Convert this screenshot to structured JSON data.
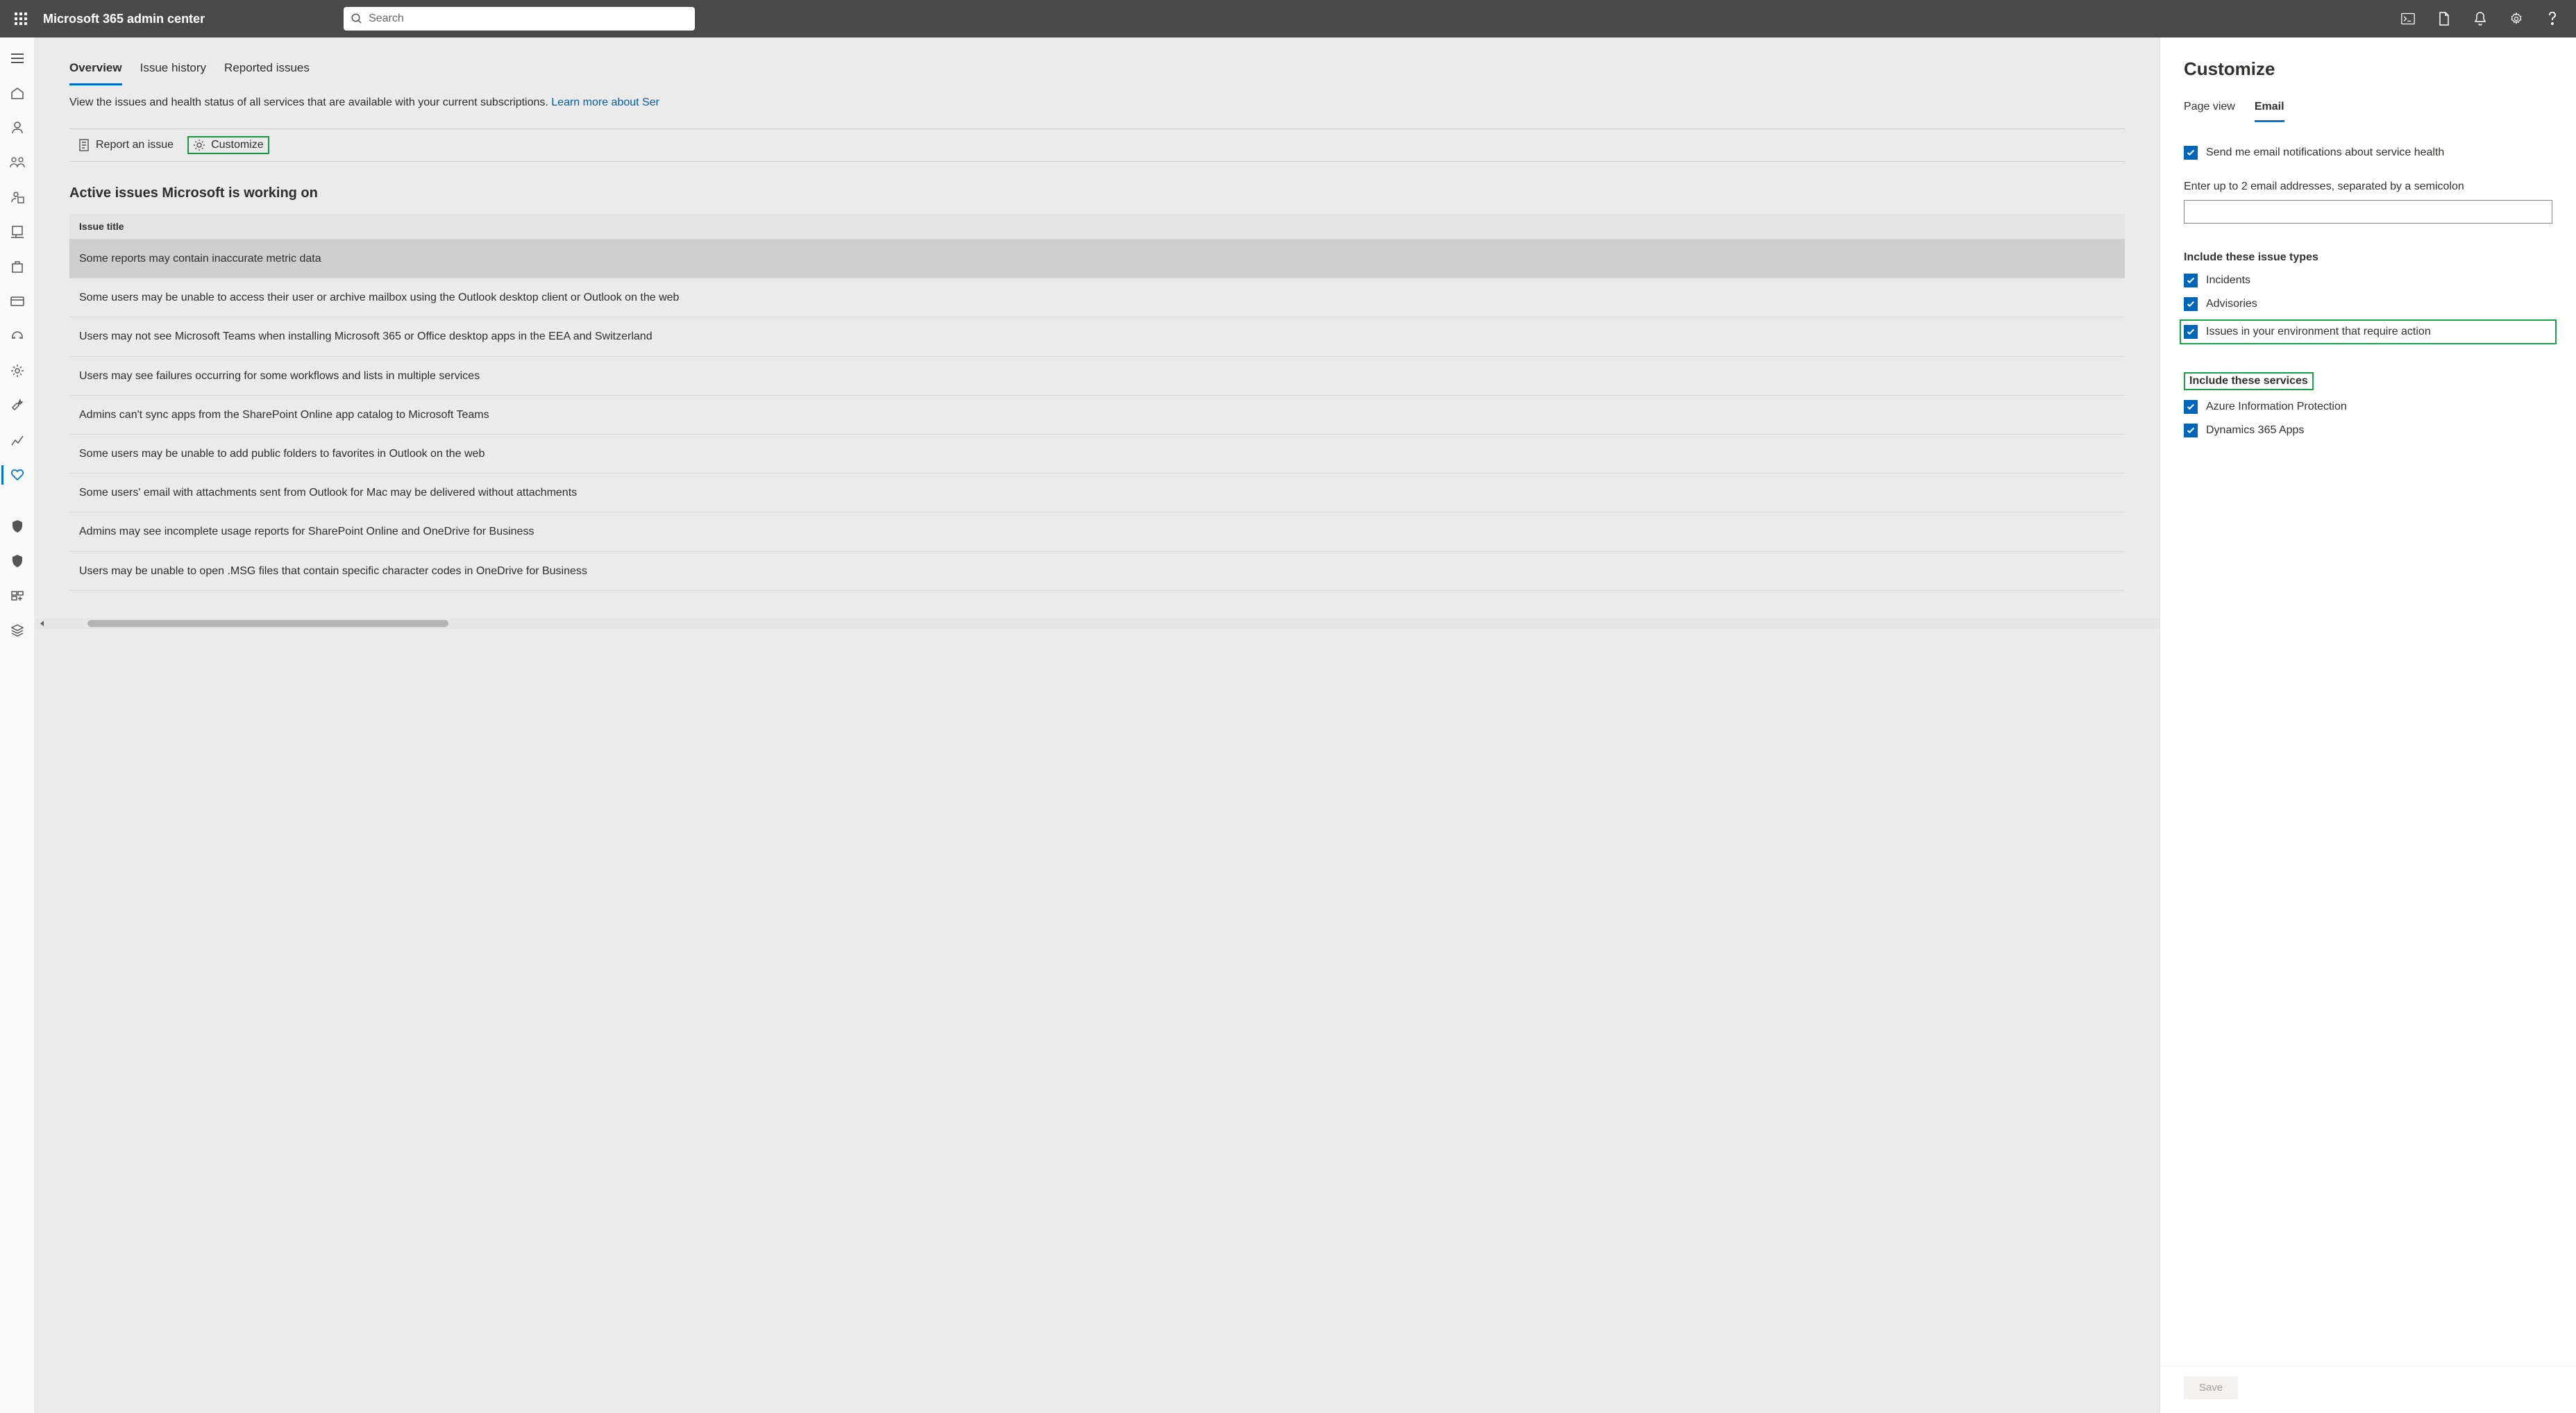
{
  "header": {
    "app_title": "Microsoft 365 admin center",
    "search_placeholder": "Search"
  },
  "page": {
    "tabs": [
      {
        "label": "Overview",
        "active": true
      },
      {
        "label": "Issue history",
        "active": false
      },
      {
        "label": "Reported issues",
        "active": false
      }
    ],
    "intro_text": "View the issues and health status of all services that are available with your current subscriptions. ",
    "intro_link": "Learn more about Ser",
    "cmd_report": "Report an issue",
    "cmd_customize": "Customize",
    "section_title": "Active issues Microsoft is working on",
    "col_header": "Issue title",
    "issues": [
      "Some reports may contain inaccurate metric data",
      "Some users may be unable to access their user or archive mailbox using the Outlook desktop client or Outlook on the web",
      "Users may not see Microsoft Teams when installing Microsoft 365 or Office desktop apps in the EEA and Switzerland",
      "Users may see failures occurring for some workflows and lists in multiple services",
      "Admins can't sync apps from the SharePoint Online app catalog to Microsoft Teams",
      "Some users may be unable to add public folders to favorites in Outlook on the web",
      "Some users' email with attachments sent from Outlook for Mac may be delivered without attachments",
      "Admins may see incomplete usage reports for SharePoint Online and OneDrive for Business",
      "Users may be unable to open .MSG files that contain specific character codes in OneDrive for Business"
    ]
  },
  "panel": {
    "title": "Customize",
    "tabs": {
      "page_view": "Page view",
      "email": "Email"
    },
    "send_me": "Send me email notifications about service health",
    "email_label": "Enter up to 2 email addresses, separated by a semicolon",
    "issue_types_head": "Include these issue types",
    "issue_types": [
      "Incidents",
      "Advisories",
      "Issues in your environment that require action"
    ],
    "services_head": "Include these services",
    "services": [
      "Azure Information Protection",
      "Dynamics 365 Apps"
    ],
    "save": "Save"
  }
}
